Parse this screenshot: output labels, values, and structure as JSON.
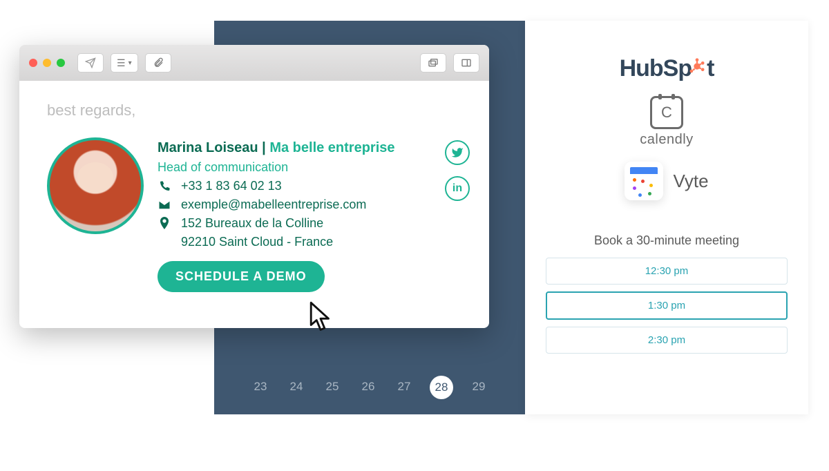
{
  "backPanel": {
    "dates": [
      "23",
      "24",
      "25",
      "26",
      "27",
      "28",
      "29"
    ],
    "selectedDate": "28"
  },
  "booking": {
    "logos": {
      "hubspot_text": "HubSp",
      "hubspot_suffix": "t",
      "calendly_letter": "C",
      "calendly_label": "calendly",
      "vyte_label": "Vyte"
    },
    "heading": "Book a 30-minute meeting",
    "slots": [
      "12:30 pm",
      "1:30 pm",
      "2:30 pm"
    ],
    "selectedSlot": "1:30 pm"
  },
  "email": {
    "regards": "best regards,",
    "signature": {
      "name": "Marina Loiseau",
      "separator": " | ",
      "company": "Ma belle entreprise",
      "role": "Head of communication",
      "phone": "+33 1 83 64 02 13",
      "email_addr": "exemple@mabelleentreprise.com",
      "address_line1": "152 Bureaux de la Colline",
      "address_line2": "92210 Saint Cloud - France",
      "cta": "SCHEDULE A DEMO"
    },
    "social": {
      "twitter": "𝕏",
      "linkedin": "in"
    }
  }
}
